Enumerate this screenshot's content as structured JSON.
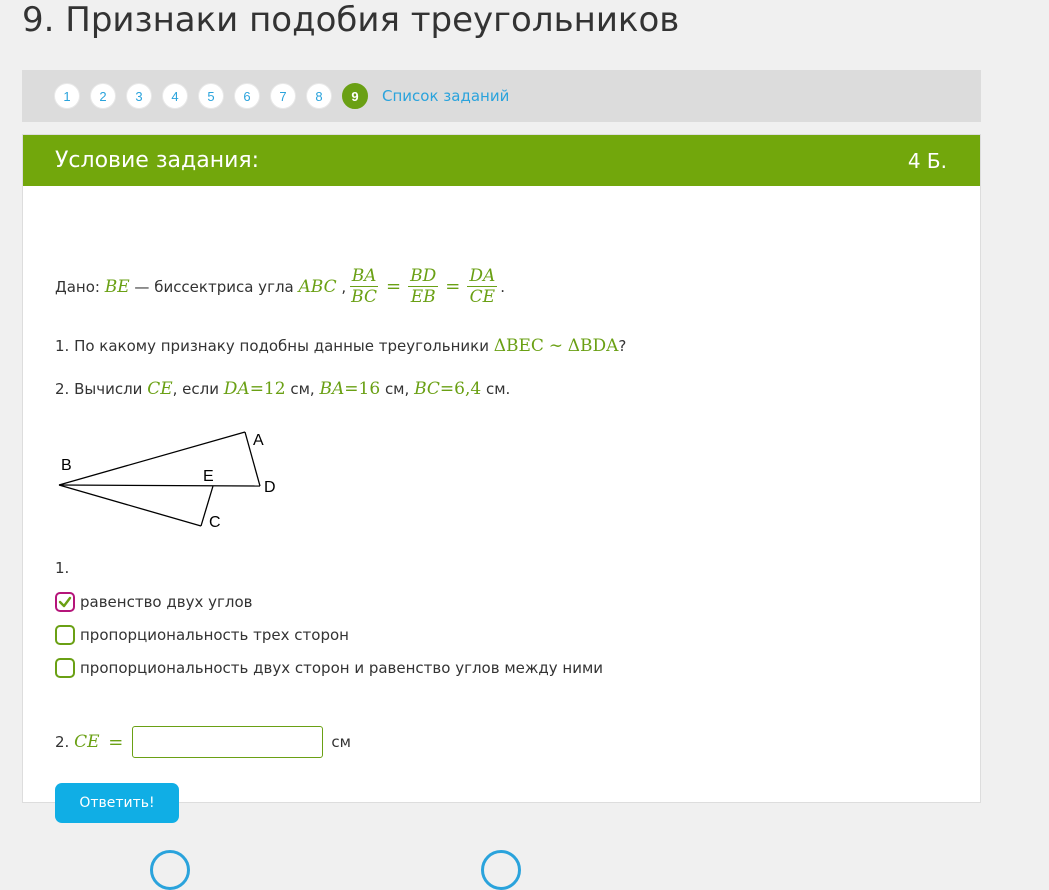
{
  "page": {
    "title": "9. Признаки подобия треугольников"
  },
  "pager": {
    "pages": [
      "1",
      "2",
      "3",
      "4",
      "5",
      "6",
      "7",
      "8",
      "9"
    ],
    "active": "9",
    "task_list_label": "Список заданий"
  },
  "card": {
    "title": "Условие задания:",
    "points": "4 Б."
  },
  "problem": {
    "given_prefix": "Дано:",
    "given_segment": "BE",
    "given_text": "— биссектриса угла",
    "given_angle": "ABC",
    "comma": ",",
    "frac1_num": "BA",
    "frac1_den": "BC",
    "frac2_num": "BD",
    "frac2_den": "EB",
    "frac3_num": "DA",
    "frac3_den": "CE",
    "eq_sign": "=",
    "period": ".",
    "q1_text": "1. По какому признаку подобны данные треугольники",
    "q1_tri1": "ΔBEC",
    "q1_sim": "∼",
    "q1_tri2": "ΔBDA",
    "q1_end": "?",
    "q2_text": "2. Вычисли",
    "q2_var": "CE",
    "q2_if": ", если",
    "q2_da": "DA",
    "q2_da_val": "=12",
    "q2_ba": "BA",
    "q2_ba_val": "=16",
    "q2_bc": "BC",
    "q2_bc_val": "=6,4",
    "unit": "см",
    "unit_comma": "см,",
    "unit_end": "см."
  },
  "figure": {
    "labels": {
      "A": "A",
      "B": "B",
      "C": "C",
      "D": "D",
      "E": "E"
    }
  },
  "answer1": {
    "label": "1.",
    "options": [
      {
        "text": "равенство двух углов",
        "checked": true
      },
      {
        "text": "пропорциональность трех сторон",
        "checked": false
      },
      {
        "text": "пропорциональность двух сторон и равенство углов между ними",
        "checked": false
      }
    ]
  },
  "answer2": {
    "label": "2.",
    "var": "CE",
    "eq": "=",
    "value": "",
    "unit": "см"
  },
  "submit_label": "Ответить!",
  "colors": {
    "accent": "#72a70c",
    "link": "#2aa3dc",
    "button": "#10aee5",
    "checked_border": "#b5157a"
  }
}
